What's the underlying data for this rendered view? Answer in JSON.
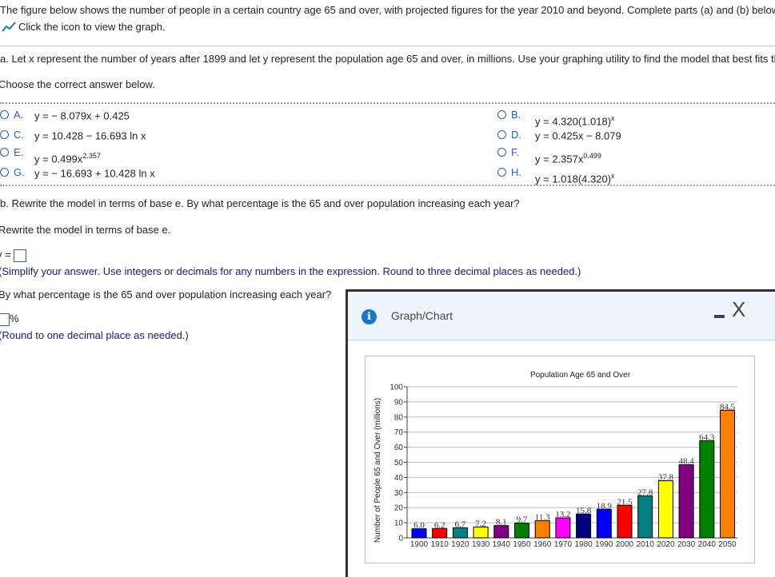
{
  "intro": "The figure below shows the number of people in a certain country age 65 and over, with projected figures for the year 2010 and beyond. Complete parts (a) and (b) below.",
  "graph_link": "Click the icon to view the graph.",
  "part_a": {
    "prompt": "a. Let x represent the number of years after 1899 and let y represent the population age 65 and over, in millions. Use your graphing utility to find the model that best fits the data.",
    "instruction": "Choose the correct answer below.",
    "options": [
      {
        "letter": "A.",
        "text": "y = − 8.079x + 0.425",
        "sup": ""
      },
      {
        "letter": "B.",
        "text": "y = 4.320(1.018)",
        "sup": "x"
      },
      {
        "letter": "C.",
        "text": "y = 10.428 − 16.693 ln x",
        "sup": ""
      },
      {
        "letter": "D.",
        "text": "y = 0.425x − 8.079",
        "sup": ""
      },
      {
        "letter": "E.",
        "text": "y = 0.499x",
        "sup": "2.357"
      },
      {
        "letter": "F.",
        "text": "y = 2.357x",
        "sup": "0.499"
      },
      {
        "letter": "G.",
        "text": "y = − 16.693 + 10.428 ln x",
        "sup": ""
      },
      {
        "letter": "H.",
        "text": "y = 1.018(4.320)",
        "sup": "x"
      }
    ]
  },
  "part_b": {
    "prompt": "b. Rewrite the model in terms of base e. By what percentage is the 65 and over population increasing each year?",
    "rewrite": "Rewrite the model in terms of base e.",
    "y_eq": "y =",
    "simplify": "(Simplify your answer. Use integers or decimals for any numbers in the expression. Round to three decimal places as needed.)",
    "pct_q": "By what percentage is the 65 and over population increasing each year?",
    "pct": "%",
    "round": "(Round to one decimal place as needed.)"
  },
  "popup": {
    "title": "Graph/Chart",
    "minimize": "-",
    "close": "X"
  },
  "chart_data": {
    "type": "bar",
    "title": "Population Age 65 and Over",
    "xlabel": "",
    "ylabel": "Number of People 65 and Over (millions)",
    "ylim": [
      0,
      100
    ],
    "yticks": [
      0,
      10,
      20,
      30,
      40,
      50,
      60,
      70,
      80,
      90,
      100
    ],
    "categories": [
      "1900",
      "1910",
      "1920",
      "1930",
      "1940",
      "1950",
      "1960",
      "1970",
      "1980",
      "1990",
      "2000",
      "2010",
      "2020",
      "2030",
      "2040",
      "2050"
    ],
    "values": [
      6.0,
      6.2,
      6.7,
      7.2,
      8.1,
      9.7,
      11.3,
      13.2,
      15.8,
      18.9,
      21.5,
      27.8,
      37.8,
      48.4,
      64.3,
      84.5
    ],
    "labels": [
      "6.0",
      "6.2",
      "6.7",
      "7.2",
      "8.1",
      "9.7",
      "11.3",
      "13.2",
      "15.8",
      "18.9",
      "21.5",
      "27.8",
      "37.8",
      "48.4",
      "64.3",
      "84.5"
    ],
    "colors": [
      "#0000ff",
      "#ff0000",
      "#008080",
      "#ffff00",
      "#800080",
      "#008000",
      "#ff8000",
      "#ff00ff",
      "#000080",
      "#0000ff",
      "#ff0000",
      "#008080",
      "#ffff00",
      "#800080",
      "#008000",
      "#ff8000"
    ],
    "grid": true
  }
}
